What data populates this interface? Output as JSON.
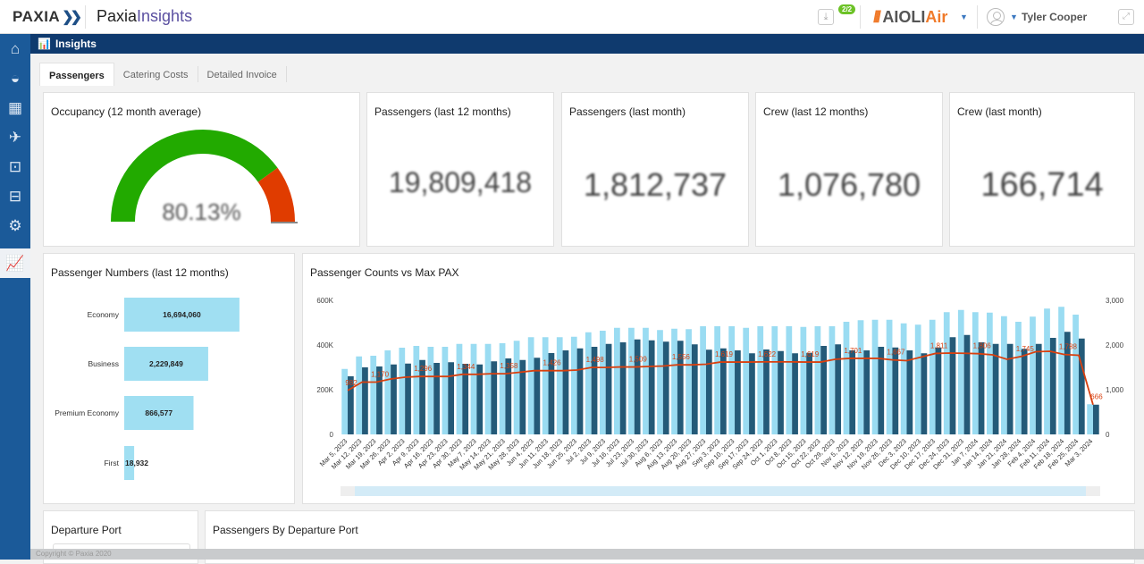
{
  "header": {
    "brand": "PAXIA",
    "app_name_prefix": "Paxia",
    "app_name_suffix": "Insights",
    "download_badge": "2/2",
    "airline_prefix": "AIOLI",
    "airline_suffix": "Air",
    "user_name": "Tyler Cooper"
  },
  "sidebar": {
    "items": [
      {
        "icon": "home-icon"
      },
      {
        "icon": "catering-cloche-icon"
      },
      {
        "icon": "calendar-icon"
      },
      {
        "icon": "airplane-icon"
      },
      {
        "icon": "money-exchange-icon"
      },
      {
        "icon": "trolley-icon"
      },
      {
        "icon": "warehouse-icon"
      },
      {
        "icon": "insights-chart-icon",
        "active": true
      }
    ]
  },
  "subbar": {
    "title": "Insights"
  },
  "tabs": [
    "Passengers",
    "Catering Costs",
    "Detailed Invoice"
  ],
  "kpis": {
    "occupancy": {
      "title": "Occupancy (12 month average)",
      "value": "80.13%",
      "fraction": 0.8013,
      "colors": {
        "fill": "#22aa00",
        "remainder": "#e03c00"
      }
    },
    "cards": [
      {
        "title": "Passengers (last 12 months)",
        "value": "19,809,418"
      },
      {
        "title": "Passengers (last month)",
        "value": "1,812,737"
      },
      {
        "title": "Crew (last 12 months)",
        "value": "1,076,780"
      },
      {
        "title": "Crew (last month)",
        "value": "166,714"
      }
    ]
  },
  "chart_data": [
    {
      "type": "bar",
      "orientation": "horizontal",
      "title": "Passenger Numbers (last 12 months)",
      "xscale": "log",
      "categories": [
        "Economy",
        "Business",
        "Premium Economy",
        "First"
      ],
      "values": [
        16694060,
        2229849,
        866577,
        18932
      ],
      "labels": [
        "16,694,060",
        "2,229,849",
        "866,577",
        "18,932"
      ],
      "color": "#a0dff2"
    },
    {
      "type": "bar+line",
      "title": "Passenger Counts vs Max PAX",
      "categories": [
        "Mar 5, 2023",
        "Mar 12, 2023",
        "Mar 19, 2023",
        "Mar 26, 2023",
        "Apr 2, 2023",
        "Apr 9, 2023",
        "Apr 16, 2023",
        "Apr 23, 2023",
        "Apr 30, 2023",
        "May 7, 2023",
        "May 14, 2023",
        "May 21, 2023",
        "May 28, 2023",
        "Jun 4, 2023",
        "Jun 11, 2023",
        "Jun 18, 2023",
        "Jun 25, 2023",
        "Jul 2, 2023",
        "Jul 9, 2023",
        "Jul 16, 2023",
        "Jul 23, 2023",
        "Jul 30, 2023",
        "Aug 6, 2023",
        "Aug 13, 2023",
        "Aug 20, 2023",
        "Aug 27, 2023",
        "Sep 3, 2023",
        "Sep 10, 2023",
        "Sep 17, 2023",
        "Sep 24, 2023",
        "Oct 1, 2023",
        "Oct 8, 2023",
        "Oct 15, 2023",
        "Oct 22, 2023",
        "Oct 29, 2023",
        "Nov 5, 2023",
        "Nov 12, 2023",
        "Nov 19, 2023",
        "Nov 26, 2023",
        "Dec 3, 2023",
        "Dec 10, 2023",
        "Dec 17, 2023",
        "Dec 24, 2023",
        "Dec 31, 2023",
        "Jan 7, 2024",
        "Jan 14, 2024",
        "Jan 21, 2024",
        "Jan 28, 2024",
        "Feb 4, 2024",
        "Feb 11, 2024",
        "Feb 18, 2024",
        "Feb 25, 2024",
        "Mar 3, 2024"
      ],
      "series": [
        {
          "axis": "left",
          "kind": "bar",
          "color": "#9adcf2",
          "values": [
            293000,
            349000,
            352000,
            376000,
            388000,
            396000,
            392000,
            392000,
            405000,
            405000,
            405000,
            408000,
            419000,
            435000,
            435000,
            435000,
            437000,
            457000,
            464000,
            477000,
            477000,
            477000,
            467000,
            473000,
            471000,
            484000,
            484000,
            484000,
            477000,
            484000,
            484000,
            484000,
            481000,
            484000,
            484000,
            504000,
            511000,
            513000,
            513000,
            497000,
            491000,
            513000,
            547000,
            557000,
            547000,
            545000,
            529000,
            504000,
            527000,
            563000,
            571000,
            536000,
            135000
          ]
        },
        {
          "axis": "left",
          "kind": "bar",
          "color": "#245a78",
          "values": [
            260000,
            300000,
            304000,
            313000,
            317000,
            333000,
            320000,
            323000,
            316000,
            313000,
            327000,
            340000,
            333000,
            343000,
            364000,
            376000,
            385000,
            392000,
            405000,
            412000,
            425000,
            421000,
            415000,
            419000,
            403000,
            379000,
            385000,
            376000,
            363000,
            380000,
            373000,
            363000,
            365000,
            396000,
            403000,
            376000,
            376000,
            392000,
            389000,
            376000,
            363000,
            389000,
            435000,
            445000,
            412000,
            405000,
            405000,
            383000,
            405000,
            432000,
            459000,
            429000,
            133000
          ]
        },
        {
          "axis": "right",
          "kind": "line",
          "color": "#d9400f",
          "values": [
            982,
            1170,
            1170,
            1240,
            1280,
            1296,
            1296,
            1296,
            1344,
            1344,
            1358,
            1358,
            1390,
            1426,
            1426,
            1426,
            1440,
            1498,
            1498,
            1509,
            1509,
            1520,
            1530,
            1556,
            1556,
            1570,
            1619,
            1619,
            1619,
            1622,
            1622,
            1622,
            1619,
            1619,
            1680,
            1701,
            1701,
            1701,
            1667,
            1650,
            1730,
            1811,
            1820,
            1815,
            1806,
            1780,
            1680,
            1745,
            1850,
            1860,
            1788,
            1770,
            666
          ],
          "data_labels": {
            "0": "982",
            "2": "1,170",
            "5": "1,296",
            "8": "1,344",
            "11": "1,358",
            "14": "1,426",
            "17": "1,498",
            "20": "1,509",
            "23": "1,556",
            "26": "1,619",
            "29": "1,622",
            "32": "1,619",
            "35": "1,701",
            "38": "1,667",
            "41": "1,811",
            "44": "1,806",
            "47": "1,745",
            "50": "1,788",
            "52": "666"
          }
        }
      ],
      "y_left": {
        "ticks": [
          "0",
          "200K",
          "400K",
          "600K"
        ],
        "range": [
          0,
          600000
        ]
      },
      "y_right": {
        "ticks": [
          "0",
          "1,000",
          "2,000",
          "3,000"
        ],
        "range": [
          0,
          3000
        ]
      },
      "grid": false
    }
  ],
  "bottom": {
    "departure_port_title": "Departure Port",
    "passengers_by_port_title": "Passengers By Departure Port"
  },
  "footer": {
    "copyright": "Copyright © Paxia 2020"
  }
}
